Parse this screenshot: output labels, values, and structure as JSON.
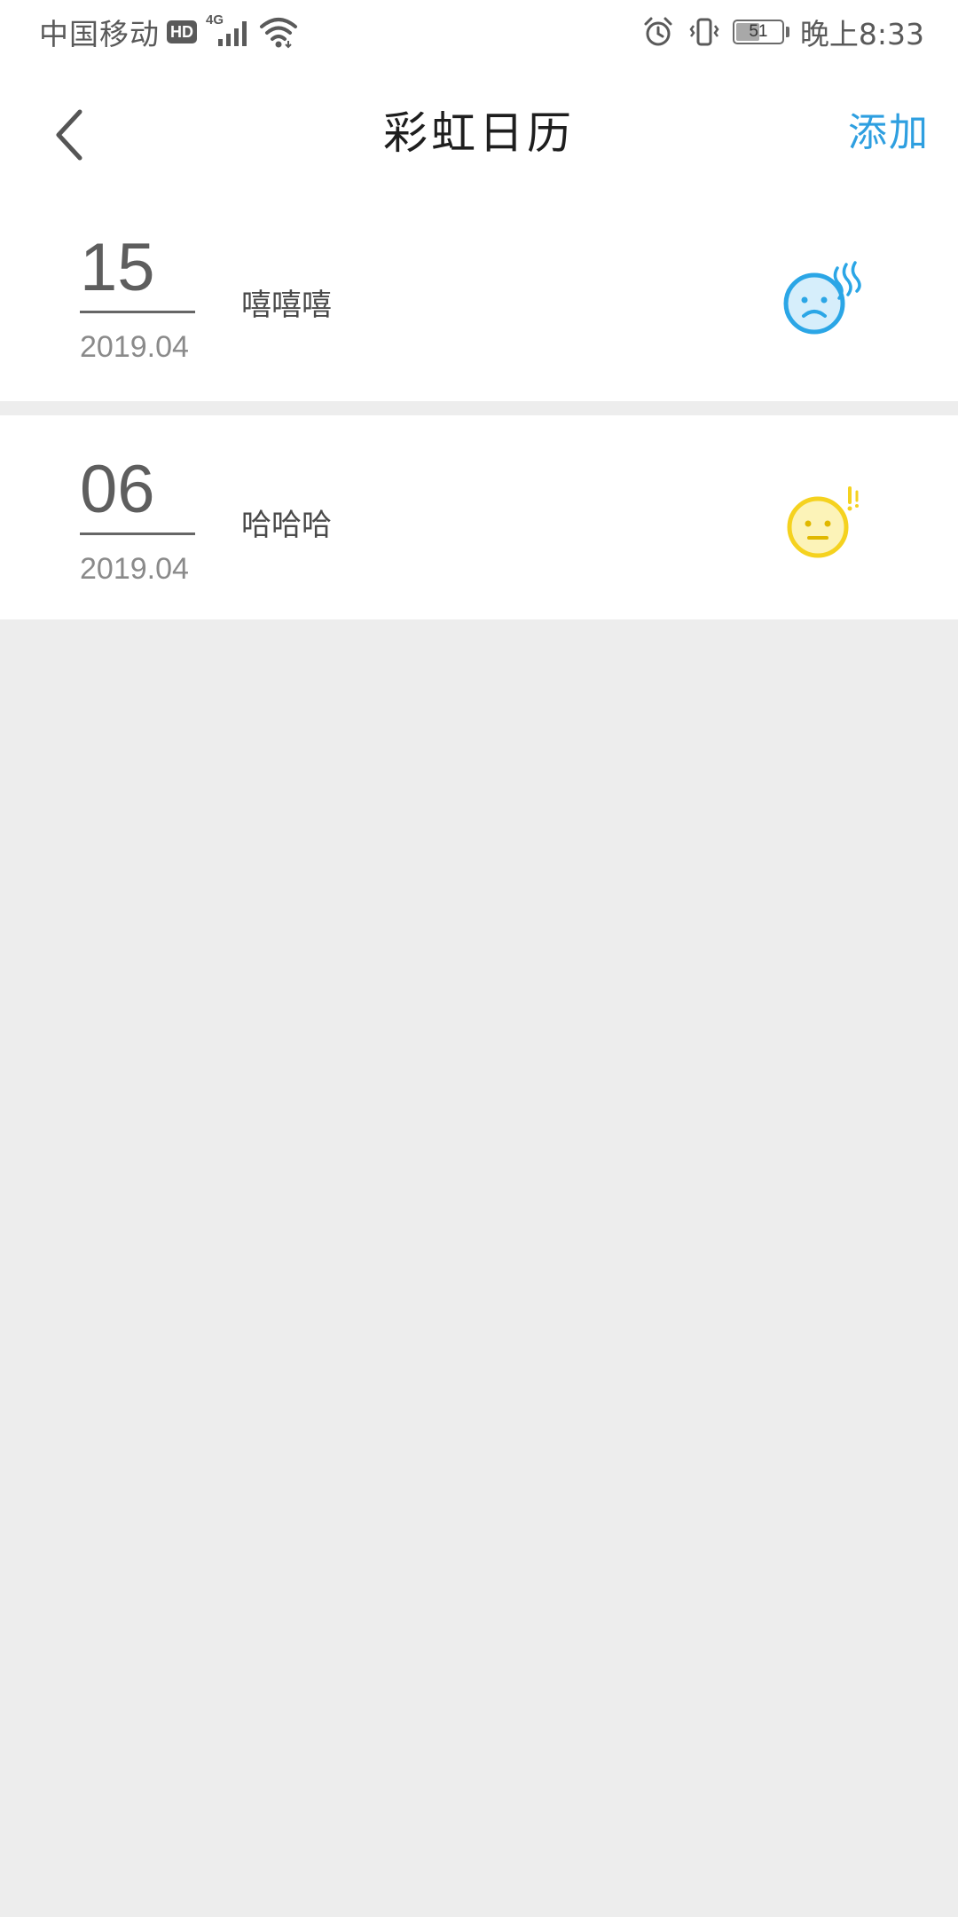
{
  "status_bar": {
    "carrier": "中国移动",
    "hd": "HD",
    "network": "4G",
    "battery": "51",
    "time": "晚上8:33",
    "icons": [
      "hd-icon",
      "signal-icon",
      "wifi-icon",
      "alarm-icon",
      "vibrate-icon",
      "battery-icon"
    ]
  },
  "nav": {
    "back_icon": "chevron-left-icon",
    "title": "彩虹日历",
    "add_label": "添加"
  },
  "entries": [
    {
      "day": "15",
      "month": "2019.04",
      "text": "嘻嘻嘻",
      "mood_icon": "sad-cold-face-icon",
      "mood_color": "#2ba6e6",
      "mood_fill": "#d6eefb"
    },
    {
      "day": "06",
      "month": "2019.04",
      "text": "哈哈哈",
      "mood_icon": "neutral-surprised-face-icon",
      "mood_color": "#f5d21f",
      "mood_fill": "#fcf3b8"
    }
  ],
  "colors": {
    "accent": "#2e9fe0",
    "background": "#ededed"
  }
}
